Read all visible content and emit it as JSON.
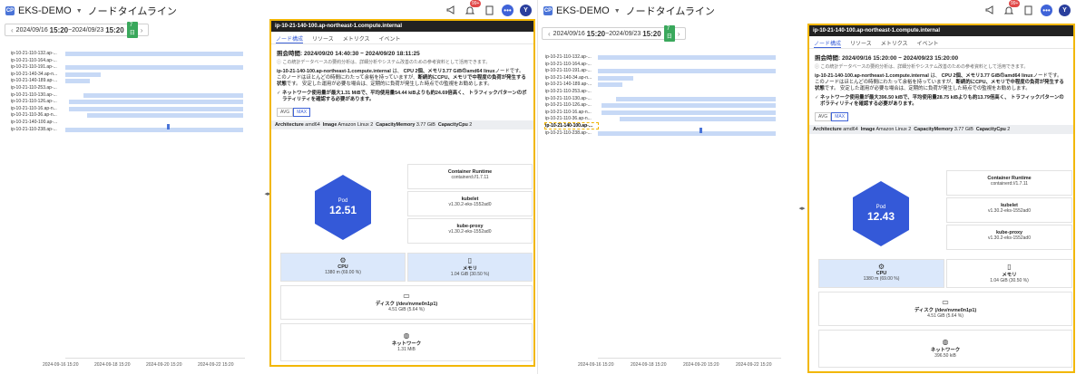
{
  "app": {
    "badge": "CP",
    "cluster": "EKS-DEMO",
    "caret": "▼",
    "page_title": "ノードタイムライン",
    "notification_count": "99+",
    "avatar_letter": "Y",
    "menu_glyph": "•••"
  },
  "left": {
    "range": {
      "start_date": "2024/09/16",
      "start_time": "15:20",
      "sep": " ~ ",
      "end_date": "2024/09/23",
      "end_time": "15:20",
      "days": "7日"
    },
    "nodes": [
      "ip-10-21-110-132.ap-...",
      "ip-10-21-110-164.ap-...",
      "ip-10-21-110-191.ap-...",
      "ip-10-21-140-34.ap-n...",
      "ip-10-21-140-189.ap-...",
      "ip-10-21-110-253.ap-...",
      "ip-10-21-110-130.ap-...",
      "ip-10-21-110-126.ap-...",
      "ip-10-21-110-16.ap-n...",
      "ip-10-21-110-36.ap-n...",
      "ip-10-21-140-100.ap-...",
      "ip-10-21-110-238.ap-..."
    ],
    "bars": [
      {
        "start": 0.0,
        "end": 1.0
      },
      {
        "start": 0.0,
        "end": 0.0
      },
      {
        "start": 0.0,
        "end": 1.0
      },
      {
        "start": 0.0,
        "end": 0.2
      },
      {
        "start": 0.0,
        "end": 0.14
      },
      {
        "start": 0.0,
        "end": 0.0
      },
      {
        "start": 0.1,
        "end": 1.0
      },
      {
        "start": 0.02,
        "end": 1.0
      },
      {
        "start": 0.02,
        "end": 1.0
      },
      {
        "start": 0.12,
        "end": 1.0
      },
      {
        "start": 0.0,
        "end": 0.0
      },
      {
        "start": 0.0,
        "end": 1.0
      }
    ],
    "selected_index": -1,
    "cursor_position": 0.57,
    "x_ticks": [
      "2024-09-16 15:20",
      "2024-09-18 15:20",
      "2024-09-20 15:20",
      "2024-09-22 15:20"
    ],
    "splitter": "◂▸",
    "detail": {
      "header": "ip-10-21-140-100.ap-northeast-1.compute.internal",
      "tabs": [
        "ノード構成",
        "リソース",
        "メトリクス",
        "イベント"
      ],
      "active_tab": 0,
      "period": "照会時間: 2024/09/20 14:40:30 ~ 2024/09/20 18:11:25",
      "note": "ⓘ この統計データベースの要約分析は、詳細分析やシステム改善のための参考資料として活用できます。",
      "desc_1": "ip-10-21-140-100.ap-northeast-1.compute.internal",
      "desc_2": " は、 ",
      "desc_3": "CPU 2個、メモリ3.77 GiBのamd64 linux",
      "desc_4": "ノードです。 このノードはほとんどの時間にわたって余裕を持っていますが、",
      "desc_5": "断続的にCPU、メモリで中程度の負荷が発生する状態",
      "desc_6": "です。 安定した運用が必要な場合は、定期的に負荷が発生した時点での監視をお勧めします。",
      "check": "ネットワーク使用量が最大1.31 MiBで、平均使用量54.44 kiBよりも約24.69倍高く、 トラフィックパターンのボラティリティを確認する必要があります。",
      "toggle": [
        "AVG",
        "MAX"
      ],
      "toggle_active": 1,
      "arch": {
        "k1": "Architecture",
        "v1": "amd64",
        "k2": "Image",
        "v2": "Amazon Linux 2",
        "k3": "CapacityMemory",
        "v3": "3.77 GiB",
        "k4": "CapacityCpu",
        "v4": "2"
      },
      "pod_label": "Pod",
      "pod_value": "12.51",
      "runtime_label": "Container Runtime",
      "runtime_value": "containerd://1.7.11",
      "kubelet_label": "kubelet",
      "kubelet_value": "v1.30.2-eks-1552ad0",
      "proxy_label": "kube-proxy",
      "proxy_value": "v1.30.2-eks-1552ad0",
      "cpu_label": "CPU",
      "cpu_value": "1380 m (69.00 %)",
      "mem_label": "メモリ",
      "mem_value": "1.04 GiB (30.50 %)",
      "disk_label": "ディスク (/dev/nvme0n1p1)",
      "disk_value": "4.51 GiB (5.64 %)",
      "net_label": "ネットワーク",
      "net_value": "1.31 MiB"
    }
  },
  "right": {
    "range": {
      "start_date": "2024/09/16",
      "start_time": "15:20",
      "sep": " ~ ",
      "end_date": "2024/09/23",
      "end_time": "15:20",
      "days": "7日"
    },
    "nodes": [
      "ip-10-21-110-132.ap-...",
      "ip-10-21-110-164.ap-...",
      "ip-10-21-110-191.ap-...",
      "ip-10-21-140-34.ap-n...",
      "ip-10-21-140-189.ap-...",
      "ip-10-21-110-253.ap-...",
      "ip-10-21-110-130.ap-...",
      "ip-10-21-110-126.ap-...",
      "ip-10-21-110-16.ap-n...",
      "ip-10-21-110-36.ap-n...",
      "ip-10-21-140-100.ap-...",
      "ip-10-21-110-238.ap-..."
    ],
    "bars": [
      {
        "start": 0.0,
        "end": 1.0
      },
      {
        "start": 0.0,
        "end": 0.0
      },
      {
        "start": 0.0,
        "end": 1.0
      },
      {
        "start": 0.0,
        "end": 0.2
      },
      {
        "start": 0.0,
        "end": 0.14
      },
      {
        "start": 0.0,
        "end": 0.0
      },
      {
        "start": 0.1,
        "end": 1.0
      },
      {
        "start": 0.02,
        "end": 1.0
      },
      {
        "start": 0.02,
        "end": 1.0
      },
      {
        "start": 0.12,
        "end": 1.0
      },
      {
        "start": 0.0,
        "end": 0.0
      },
      {
        "start": 0.0,
        "end": 1.0
      }
    ],
    "selected_index": 10,
    "cursor_position": 0.57,
    "x_ticks": [
      "2024-09-16 15:20",
      "2024-09-18 15:20",
      "2024-09-20 15:20",
      "2024-09-22 15:20"
    ],
    "splitter": "◂▸",
    "detail": {
      "header": "ip-10-21-140-100.ap-northeast-1.compute.internal",
      "tabs": [
        "ノード構成",
        "リソース",
        "メトリクス",
        "イベント"
      ],
      "active_tab": 0,
      "period": "照会時間: 2024/09/16 15:20:00 ~ 2024/09/23 15:20:00",
      "note": "ⓘ この統計データベースの要約分析は、詳細分析やシステム改善のための参考資料として活用できます。",
      "desc_1": "ip-10-21-140-100.ap-northeast-1.compute.internal",
      "desc_2": " は、 ",
      "desc_3": "CPU 2個、メモリ3.77 GiBのamd64 linux",
      "desc_4": "ノードです。 このノードはほとんどの時間にわたって余裕を持っていますが、",
      "desc_5": "断続的にCPU、メモリで中程度の負荷が発生する状態",
      "desc_6": "です。 安定した運用が必要な場合は、定期的に負荷が発生した時点での監視をお勧めします。",
      "check": "ネットワーク使用量が最大396.50 kiBで、平均使用量28.75 kiBよりも約13.79倍高く、 トラフィックパターンのボラティリティを確認する必要があります。",
      "toggle": [
        "AVG",
        "MAX"
      ],
      "toggle_active": 1,
      "arch": {
        "k1": "Architecture",
        "v1": "amd64",
        "k2": "Image",
        "v2": "Amazon Linux 2",
        "k3": "CapacityMemory",
        "v3": "3.77 GiB",
        "k4": "CapacityCpu",
        "v4": "2"
      },
      "pod_label": "Pod",
      "pod_value": "12.43",
      "runtime_label": "Container Runtime",
      "runtime_value": "containerd://1.7.11",
      "kubelet_label": "kubelet",
      "kubelet_value": "v1.30.2-eks-1552ad0",
      "proxy_label": "kube-proxy",
      "proxy_value": "v1.30.2-eks-1552ad0",
      "cpu_label": "CPU",
      "cpu_value": "1380 m (69.00 %)",
      "mem_label": "メモリ",
      "mem_value": "1.04 GiB (30.50 %)",
      "disk_label": "ディスク (/dev/nvme0n1p1)",
      "disk_value": "4.51 GiB (5.64 %)",
      "net_label": "ネットワーク",
      "net_value": "396.50 kiB"
    }
  }
}
